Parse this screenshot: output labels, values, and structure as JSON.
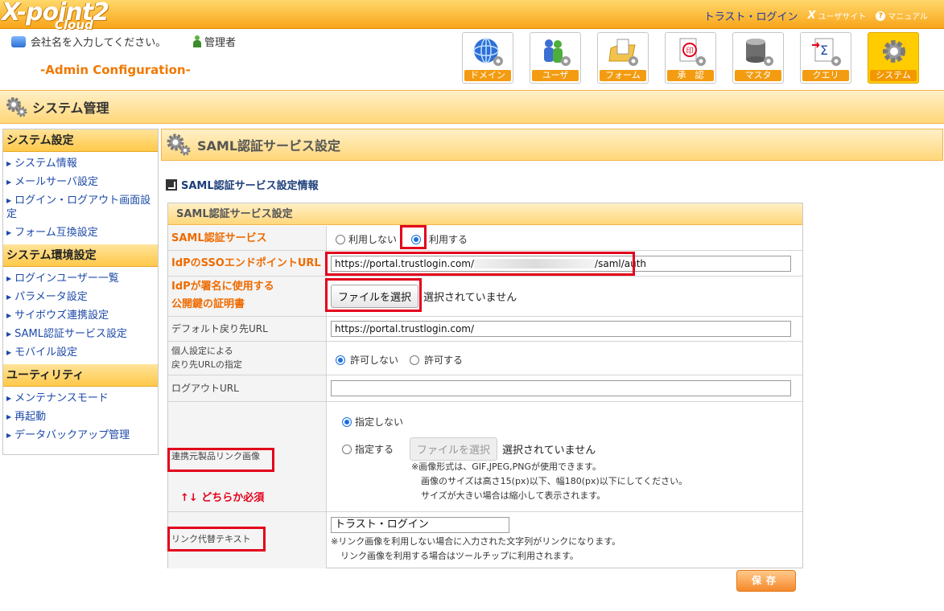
{
  "app": {
    "logo_main": "X-point2",
    "logo_sub": "Cloud",
    "top_links": {
      "trust_login": "トラスト・ログイン",
      "user_site": "ユーザサイト",
      "manual": "マニュアル"
    },
    "company_placeholder": "会社名を入力してください。",
    "admin_label": "管理者",
    "admin_config": "-Admin Configuration-",
    "nav": [
      {
        "label": "ドメイン",
        "icon": "globe-icon"
      },
      {
        "label": "ユーザ",
        "icon": "users-icon"
      },
      {
        "label": "フォーム",
        "icon": "form-icon"
      },
      {
        "label": "承　認",
        "icon": "approval-stamp-icon"
      },
      {
        "label": "マスタ",
        "icon": "database-icon"
      },
      {
        "label": "クエリ",
        "icon": "query-icon"
      },
      {
        "label": "システム",
        "icon": "system-gear-icon",
        "active": true
      }
    ]
  },
  "page_title": "システム管理",
  "sidebar": {
    "sections": [
      {
        "title": "システム設定",
        "items": [
          "システム情報",
          "メールサーバ設定",
          "ログイン・ログアウト画面設定",
          "フォーム互換設定"
        ]
      },
      {
        "title": "システム環境設定",
        "items": [
          "ログインユーザー一覧",
          "パラメータ設定",
          "サイボウズ連携設定",
          "SAML認証サービス設定",
          "モバイル設定"
        ]
      },
      {
        "title": "ユーティリティ",
        "items": [
          "メンテナンスモード",
          "再起動",
          "データバックアップ管理"
        ]
      }
    ]
  },
  "main": {
    "section_title": "SAML認証サービス設定",
    "sub_heading": "SAML認証サービス設定情報",
    "form_title": "SAML認証サービス設定",
    "rows": {
      "saml_service": {
        "label": "SAML認証サービス",
        "opt_off": "利用しない",
        "opt_on": "利用する",
        "selected": "利用する"
      },
      "idp_sso": {
        "label": "IdPのSSOエンドポイントURL",
        "value_prefix": "https://portal.trustlogin.com/",
        "value_suffix": "/saml/auth"
      },
      "idp_cert": {
        "label_line1": "IdPが署名に使用する",
        "label_line2": "公開鍵の証明書",
        "button": "ファイルを選択",
        "status": "選択されていません"
      },
      "default_return": {
        "label": "デフォルト戻り先URL",
        "value": "https://portal.trustlogin.com/"
      },
      "personal_return": {
        "label_line1": "個人設定による",
        "label_line2": "戻り先URLの指定",
        "opt_off": "許可しない",
        "opt_on": "許可する",
        "selected": "許可しない"
      },
      "logout_url": {
        "label": "ログアウトURL",
        "value": ""
      },
      "link_image": {
        "label": "連携元製品リンク画像",
        "opt_none": "指定しない",
        "opt_specify": "指定する",
        "selected": "指定しない",
        "button": "ファイルを選択",
        "status": "選択されていません",
        "note1": "※画像形式は、GIF,JPEG,PNGが使用できます。",
        "note2": "画像のサイズは高さ15(px)以下、幅180(px)以下にしてください。",
        "note3": "サイズが大きい場合は縮小して表示されます。"
      },
      "link_text": {
        "label": "リンク代替テキスト",
        "value": "トラスト・ログイン",
        "note1": "※リンク画像を利用しない場合に入力された文字列がリンクになります。",
        "note2": "リンク画像を利用する場合はツールチップに利用されます。"
      }
    },
    "must_note": "↑↓ どちらか必須",
    "save_label": "保存"
  },
  "colors": {
    "accent_orange": "#f39800",
    "annotation_red": "#e3001b",
    "link_blue": "#1d4aa8"
  }
}
